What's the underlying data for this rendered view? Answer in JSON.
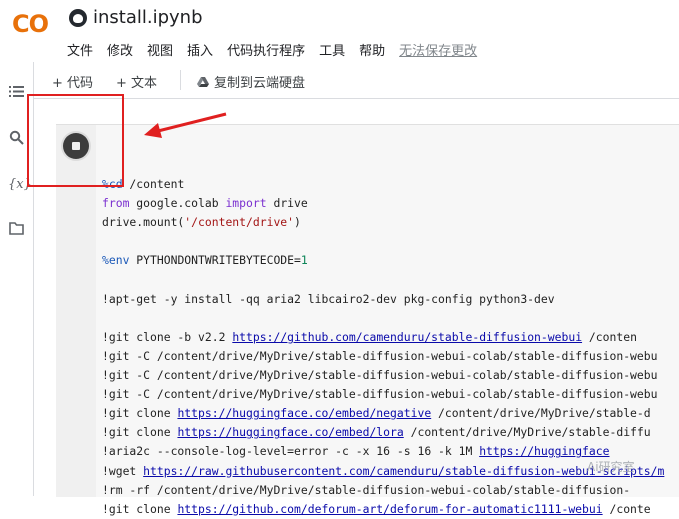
{
  "header": {
    "logo": "CO",
    "title": "install.ipynb",
    "menu": [
      "文件",
      "修改",
      "视图",
      "插入",
      "代码执行程序",
      "工具",
      "帮助"
    ],
    "unsaved": "无法保存更改"
  },
  "rail": {
    "icons": [
      "list-icon",
      "search-icon",
      "variables-icon",
      "folder-icon"
    ]
  },
  "toolbar": {
    "add_code": "+ 代码",
    "add_text": "+ 文本",
    "copy_drive": "复制到云端硬盘"
  },
  "code_lines": [
    "",
    "%cd /content",
    "from google.colab import drive",
    "drive.mount('/content/drive')",
    "",
    "%env PYTHONDONTWRITEBYTECODE=1",
    "",
    "!apt-get -y install -qq aria2 libcairo2-dev pkg-config python3-dev",
    "",
    "!git clone -b v2.2 https://github.com/camenduru/stable-diffusion-webui /conten",
    "!git -C /content/drive/MyDrive/stable-diffusion-webui-colab/stable-diffusion-webu",
    "!git -C /content/drive/MyDrive/stable-diffusion-webui-colab/stable-diffusion-webu",
    "!git -C /content/drive/MyDrive/stable-diffusion-webui-colab/stable-diffusion-webu",
    "!git clone https://huggingface.co/embed/negative /content/drive/MyDrive/stable-d",
    "!git clone https://huggingface.co/embed/lora /content/drive/MyDrive/stable-diffu",
    "!aria2c --console-log-level=error -c -x 16 -s 16 -k 1M https://huggingface",
    "!wget https://raw.githubusercontent.com/camenduru/stable-diffusion-webui-scripts/m",
    "!rm -rf /content/drive/MyDrive/stable-diffusion-webui-colab/stable-diffusion-",
    "!git clone https://github.com/deforum-art/deforum-for-automatic1111-webui /conte"
  ],
  "watermark": "Ai研究室",
  "colors": {
    "annotation": "#e02020",
    "brand_orange": "#f9ab00",
    "keyword": "#7b30d0"
  }
}
